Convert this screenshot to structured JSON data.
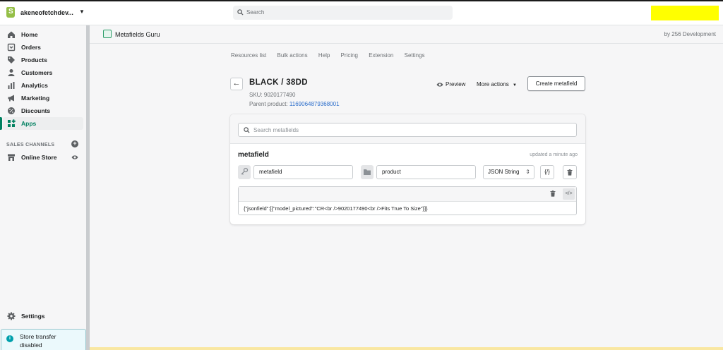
{
  "topbar": {
    "store_name": "akeneofetchdev...",
    "search_placeholder": "Search"
  },
  "sidebar": {
    "items": [
      {
        "label": "Home",
        "icon": "home-icon"
      },
      {
        "label": "Orders",
        "icon": "orders-icon"
      },
      {
        "label": "Products",
        "icon": "tag-icon"
      },
      {
        "label": "Customers",
        "icon": "person-icon"
      },
      {
        "label": "Analytics",
        "icon": "bar-chart-icon"
      },
      {
        "label": "Marketing",
        "icon": "megaphone-icon"
      },
      {
        "label": "Discounts",
        "icon": "discount-icon"
      },
      {
        "label": "Apps",
        "icon": "apps-icon",
        "active": true
      }
    ],
    "sales_channels_label": "SALES CHANNELS",
    "online_store_label": "Online Store",
    "settings_label": "Settings",
    "transfer": {
      "line1": "Store transfer",
      "line2": "disabled"
    }
  },
  "app": {
    "title": "Metafields Guru",
    "by": "by 256 Development",
    "tabs": [
      "Resources list",
      "Bulk actions",
      "Help",
      "Pricing",
      "Extension",
      "Settings"
    ]
  },
  "page": {
    "title": "BLACK / 38DD",
    "sku": "SKU: 9020177490",
    "parent_label": "Parent product: ",
    "parent_id": "1169064879368001",
    "preview_label": "Preview",
    "more_actions_label": "More actions",
    "create_label": "Create metafield"
  },
  "card": {
    "search_placeholder": "Search metafields",
    "metafield_name": "metafield",
    "updated": "updated a minute ago",
    "key_value": "metafield",
    "namespace_value": "product",
    "type_value": "JSON String",
    "format_label": "{/}",
    "code_view_label": "</>",
    "json_value": "{\"jsonfield\":[{\"model_pictured\":\"CR<br />9020177490<br />Fits True To Size\"}]}"
  },
  "colors": {
    "accent": "#008060",
    "link": "#2c6ecb",
    "highlight": "#ffff00"
  }
}
